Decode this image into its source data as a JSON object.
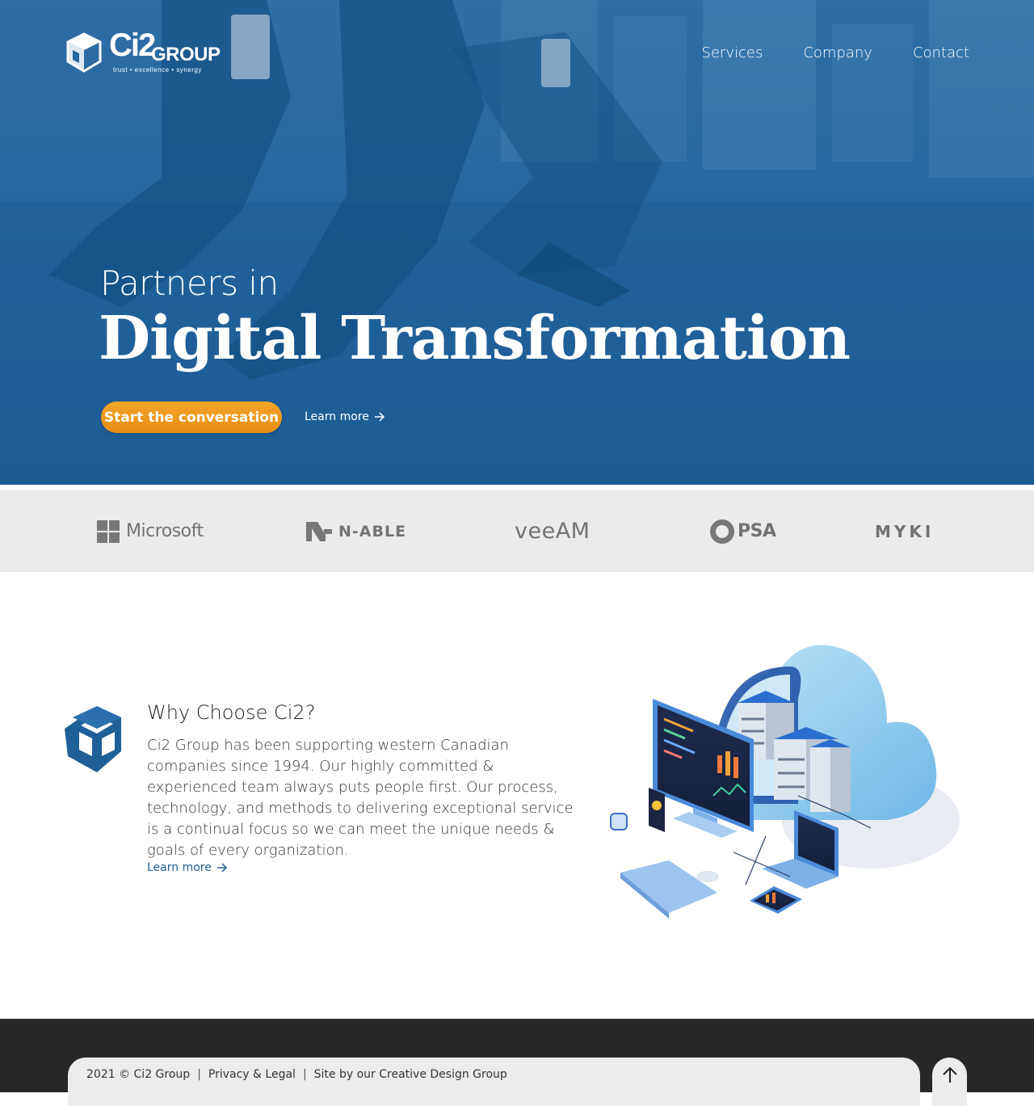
{
  "header": {
    "logo": {
      "brand": "Ci2",
      "group": "GROUP",
      "tagline": "trust  •  excellence  •  synergy"
    },
    "nav": [
      {
        "label": "Services"
      },
      {
        "label": "Company"
      },
      {
        "label": "Contact"
      }
    ]
  },
  "hero": {
    "subtitle": "Partners in",
    "title": "Digital Transformation",
    "cta_label": "Start the conversation",
    "learn_more_label": "Learn more",
    "colors": {
      "overlay": "#2467a0",
      "cta": "#ee9a1d"
    }
  },
  "partners": [
    {
      "name": "Microsoft",
      "icon": "windows-grid-icon"
    },
    {
      "name": "N-ABLE",
      "icon": "n-able-mark-icon"
    },
    {
      "name": "veeAM",
      "icon": "veeam-wordmark"
    },
    {
      "name": "PSA",
      "icon": "psa-ring-icon"
    },
    {
      "name": "MYKI",
      "icon": "myki-wordmark"
    }
  ],
  "why": {
    "title": "Why Choose Ci2?",
    "body": "Ci2 Group has been supporting western Canadian companies since 1994. Our highly committed & experienced team always puts people first. Our process, technology, and methods to delivering exceptional service is a continual focus so we can meet the unique needs & goals of every organization.",
    "learn_more_label": "Learn more",
    "icon": "cube-icon",
    "illustration": "cloud-datacenter-illustration"
  },
  "footer": {
    "copyright": "2021 © Ci2 Group",
    "privacy_label": "Privacy & Legal",
    "credit_label": "Site by our Creative Design Group",
    "separator": "|",
    "to_top_icon": "arrow-up-icon"
  }
}
